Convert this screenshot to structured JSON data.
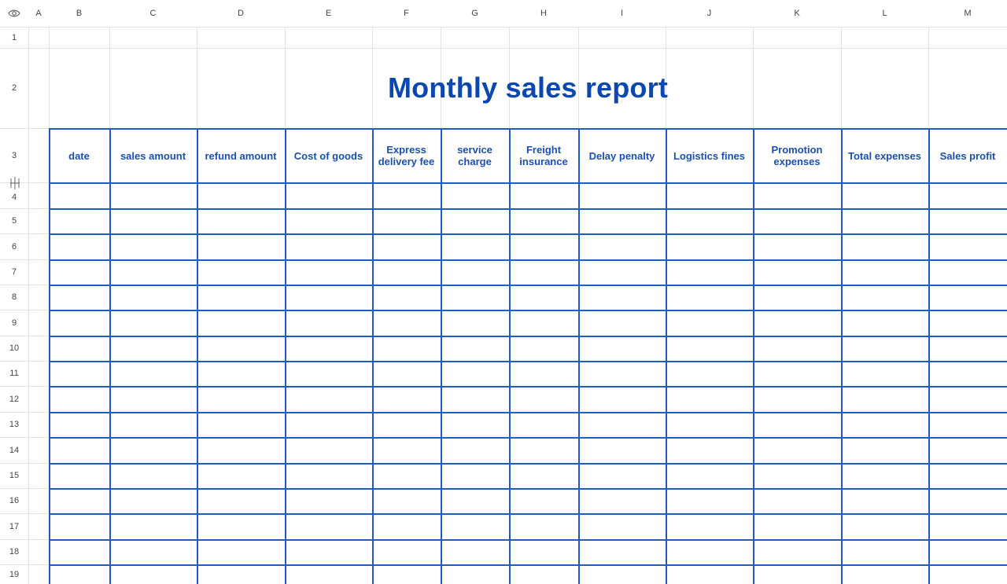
{
  "sheet": {
    "columns": [
      "A",
      "B",
      "C",
      "D",
      "E",
      "F",
      "G",
      "H",
      "I",
      "J",
      "K",
      "L",
      "M"
    ],
    "rows": [
      "1",
      "2",
      "3",
      "4",
      "5",
      "6",
      "7",
      "8",
      "9",
      "10",
      "11",
      "12",
      "13",
      "14",
      "15",
      "16",
      "17",
      "18",
      "19"
    ],
    "title": "Monthly sales report",
    "headers": [
      "date",
      "sales amount",
      "refund amount",
      "Cost of goods",
      "Express delivery fee",
      "service charge",
      "Freight insurance",
      "Delay penalty",
      "Logistics fines",
      "Promotion expenses",
      "Total expenses",
      "Sales profit"
    ]
  },
  "colors": {
    "title": "#0b47b3",
    "header_text": "#1a50b5",
    "table_border": "#1f5bc4",
    "gridline": "#e3e3e3"
  },
  "icons": {
    "corner": "eye-icon",
    "column_resize": "column-resize-icon",
    "row_resize": "row-resize-icon"
  }
}
